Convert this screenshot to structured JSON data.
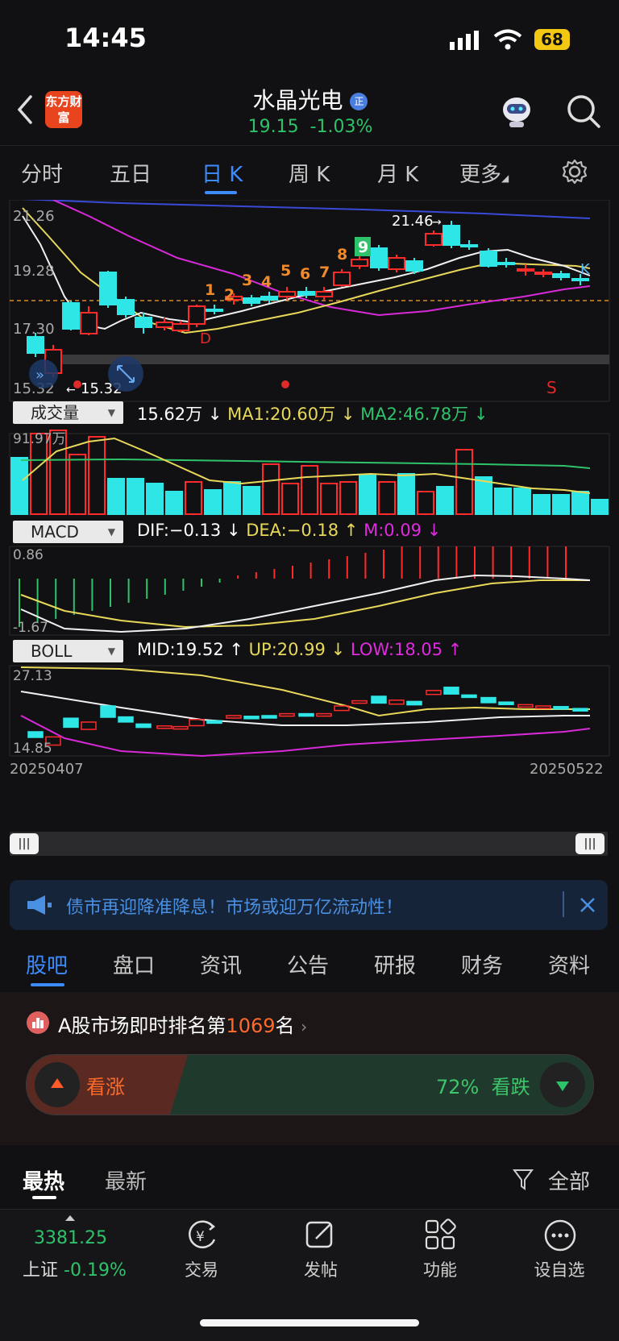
{
  "status_bar": {
    "time": "14:45",
    "battery": "68"
  },
  "header": {
    "logo_text": "东方财富",
    "stock_name": "水晶光电",
    "badge": "正",
    "price": "19.15",
    "change": "-1.03%"
  },
  "period_tabs": [
    "分时",
    "五日",
    "日 K",
    "周 K",
    "月 K",
    "更多"
  ],
  "kline": {
    "price_labels": [
      "21.26",
      "19.28",
      "17.30",
      "15.32"
    ],
    "high_label": "21.46",
    "low_label": "15.32",
    "seq_numbers": [
      "1",
      "2",
      "3",
      "4",
      "5",
      "6",
      "7",
      "8",
      "9"
    ],
    "marker_d": "D",
    "marker_k": "K",
    "marker_s": "S"
  },
  "volume": {
    "selector": "成交量",
    "value": "15.62万",
    "ma1": "MA1:20.60万",
    "ma2": "MA2:46.78万",
    "axis_label": "91.97万"
  },
  "macd": {
    "selector": "MACD",
    "dif": "DIF:−0.13",
    "dea": "DEA:−0.18",
    "m": "M:0.09",
    "axis_top": "0.86",
    "axis_bottom": "-1.67"
  },
  "boll": {
    "selector": "BOLL",
    "mid": "MID:19.52",
    "up": "UP:20.99",
    "low": "LOW:18.05",
    "axis_top": "27.13",
    "axis_bottom": "14.85",
    "date_start": "20250407",
    "date_end": "20250522"
  },
  "banner": {
    "text": "债市再迎降准降息！市场或迎万亿流动性！"
  },
  "bottom_tabs": [
    "股吧",
    "盘口",
    "资讯",
    "公告",
    "研报",
    "财务",
    "资料"
  ],
  "ranking": {
    "prefix": "A股市场即时排名第",
    "rank": "1069",
    "suffix": "名"
  },
  "vote": {
    "bull_label": "看涨",
    "bear_label": "看跌",
    "bear_pct": "72%"
  },
  "feed_tabs": {
    "hot": "最热",
    "new": "最新",
    "filter": "全部"
  },
  "bottom_nav": {
    "index_value": "3381.25",
    "index_name": "上证",
    "index_change": "-0.19%",
    "items": [
      "交易",
      "发帖",
      "功能",
      "设自选"
    ]
  },
  "colors": {
    "up": "#ff2a2a",
    "down": "#2ee6e6",
    "accent": "#3d8cff",
    "green": "#2ec36a"
  }
}
